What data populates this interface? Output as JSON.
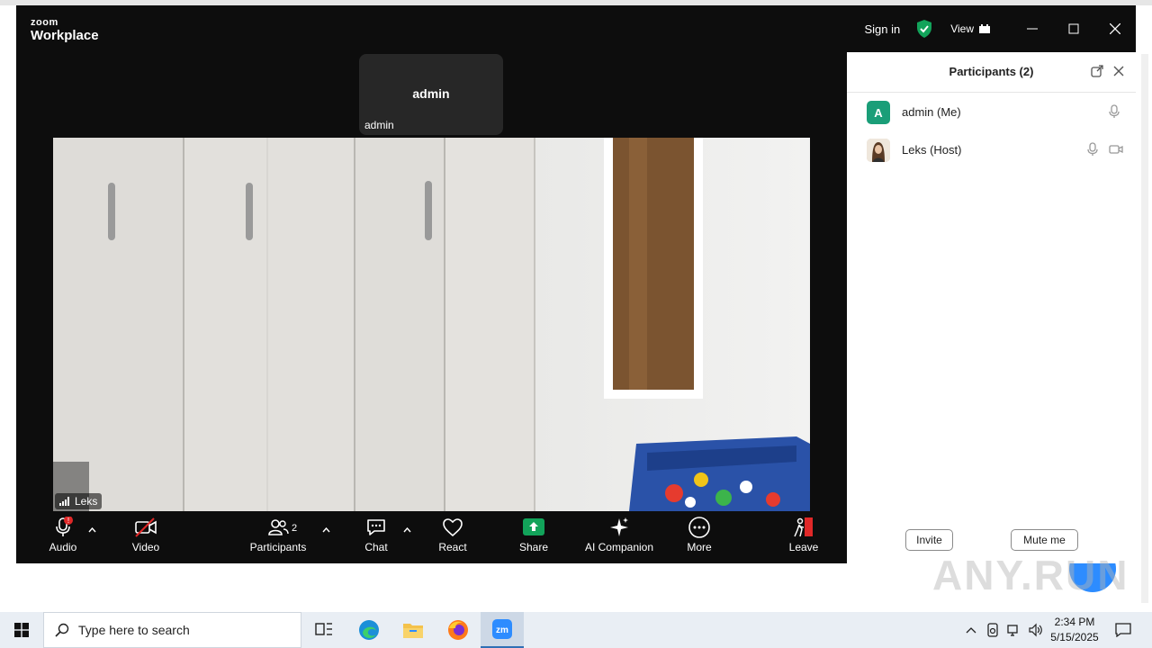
{
  "app": {
    "logo_top": "zoom",
    "logo_bottom": "Workplace",
    "sign_in": "Sign in",
    "view_label": "View"
  },
  "meeting": {
    "thumbnail_name": "admin",
    "thumbnail_label": "admin",
    "speaker_name": "Leks"
  },
  "toolbar": {
    "audio": "Audio",
    "video": "Video",
    "participants": "Participants",
    "participants_count": "2",
    "chat": "Chat",
    "react": "React",
    "share": "Share",
    "ai_companion": "AI Companion",
    "more": "More",
    "leave": "Leave",
    "audio_alert": "!"
  },
  "panel": {
    "title": "Participants (2)",
    "participants": [
      {
        "avatar_letter": "A",
        "name": "admin (Me)",
        "avatar_color": "#1a9e78"
      },
      {
        "avatar_letter": "",
        "name": "Leks (Host)"
      }
    ],
    "invite": "Invite",
    "mute_me": "Mute me"
  },
  "taskbar": {
    "search_placeholder": "Type here to search",
    "time": "2:34 PM",
    "date": "5/15/2025"
  },
  "colors": {
    "accent_green": "#12a35a",
    "leave_red": "#e02828",
    "zoom_blue": "#2d8cff"
  },
  "watermark": "ANY.RUN"
}
